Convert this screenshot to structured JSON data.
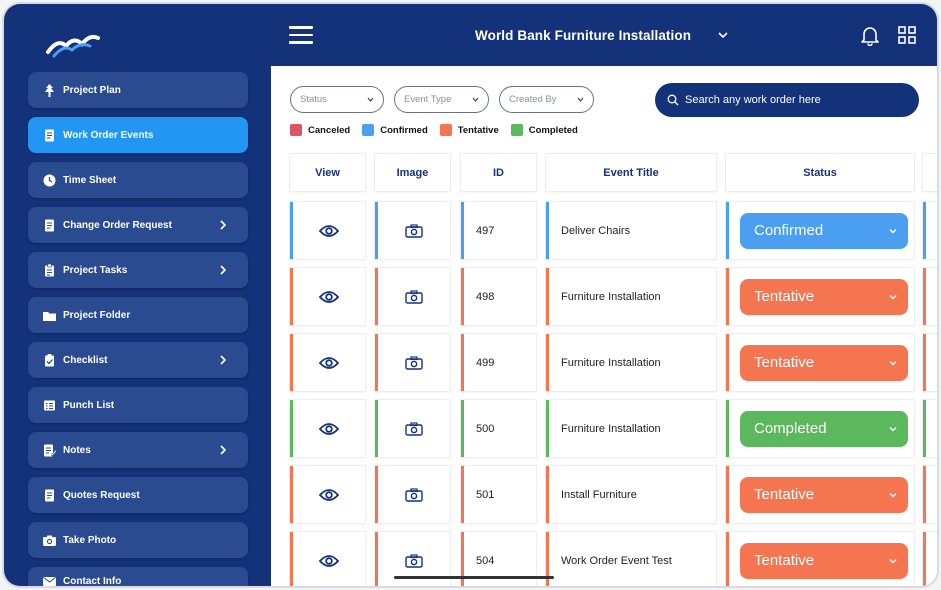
{
  "app": {
    "title": "World Bank Furniture Installation"
  },
  "sidebar": {
    "items": [
      {
        "label": "Project Plan",
        "icon": "tree-icon",
        "active": false,
        "chevron": false
      },
      {
        "label": "Work Order Events",
        "icon": "document-icon",
        "active": true,
        "chevron": false
      },
      {
        "label": "Time Sheet",
        "icon": "clock-icon",
        "active": false,
        "chevron": false
      },
      {
        "label": "Change Order Request",
        "icon": "document-icon",
        "active": false,
        "chevron": true
      },
      {
        "label": "Project Tasks",
        "icon": "clipboard-icon",
        "active": false,
        "chevron": true
      },
      {
        "label": "Project Folder",
        "icon": "folder-icon",
        "active": false,
        "chevron": false
      },
      {
        "label": "Checklist",
        "icon": "clipboard-check-icon",
        "active": false,
        "chevron": true
      },
      {
        "label": "Punch List",
        "icon": "list-icon",
        "active": false,
        "chevron": false
      },
      {
        "label": "Notes",
        "icon": "notes-icon",
        "active": false,
        "chevron": true
      },
      {
        "label": "Quotes Request",
        "icon": "document-icon",
        "active": false,
        "chevron": false
      },
      {
        "label": "Take Photo",
        "icon": "camera-icon",
        "active": false,
        "chevron": false
      },
      {
        "label": "Contact Info",
        "icon": "envelope-icon",
        "active": false,
        "chevron": false
      }
    ]
  },
  "filters": {
    "status": "Status",
    "event_type": "Event Type",
    "created_by": "Created By"
  },
  "search": {
    "placeholder": "Search any work order here"
  },
  "legend": [
    {
      "label": "Canceled",
      "color": "#e05563"
    },
    {
      "label": "Confirmed",
      "color": "#4a9ff0"
    },
    {
      "label": "Tentative",
      "color": "#f47550"
    },
    {
      "label": "Completed",
      "color": "#5cb85c"
    }
  ],
  "table": {
    "headers": {
      "view": "View",
      "image": "Image",
      "id": "ID",
      "event_title": "Event Title",
      "status": "Status"
    },
    "rows": [
      {
        "id": "497",
        "title": "Deliver Chairs",
        "status": "Confirmed",
        "color": "#4a9ff0"
      },
      {
        "id": "498",
        "title": "Furniture Installation",
        "status": "Tentative",
        "color": "#f47550"
      },
      {
        "id": "499",
        "title": "Furniture Installation",
        "status": "Tentative",
        "color": "#f47550"
      },
      {
        "id": "500",
        "title": "Furniture Installation",
        "status": "Completed",
        "color": "#5cb85c"
      },
      {
        "id": "501",
        "title": "Install Furniture",
        "status": "Tentative",
        "color": "#f47550"
      },
      {
        "id": "504",
        "title": "Work Order Event Test",
        "status": "Tentative",
        "color": "#f47550"
      }
    ]
  }
}
